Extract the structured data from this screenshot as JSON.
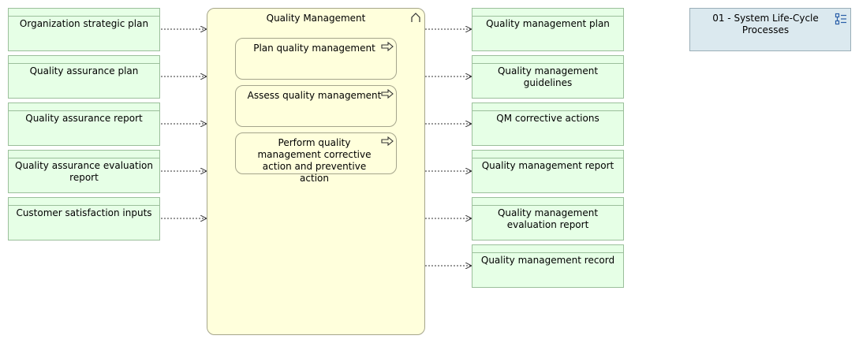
{
  "inputs": [
    "Organization strategic plan",
    "Quality assurance plan",
    "Quality assurance report",
    "Quality assurance evaluation report",
    "Customer satisfaction inputs"
  ],
  "process": {
    "title": "Quality Management",
    "functions": [
      "Plan quality management",
      "Assess quality management",
      "Perform quality management corrective action and preventive action"
    ]
  },
  "outputs": [
    "Quality management plan",
    "Quality management guidelines",
    "QM corrective actions",
    "Quality management report",
    "Quality management evaluation report",
    "Quality management record"
  ],
  "reference": {
    "label": "01 - System Life-Cycle Processes"
  }
}
